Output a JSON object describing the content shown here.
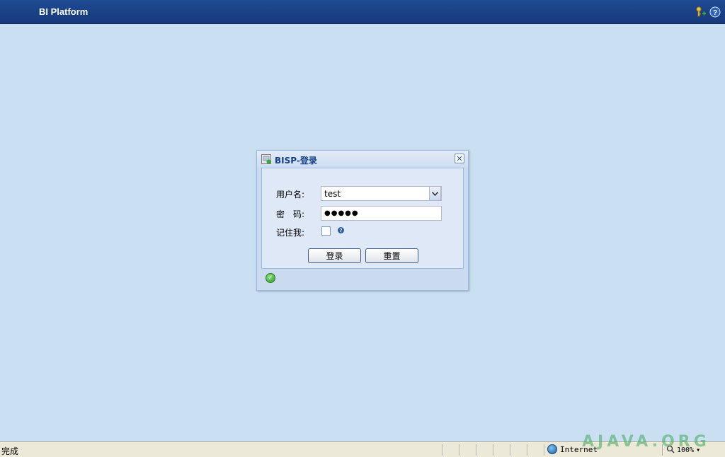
{
  "app": {
    "title": "BI Platform"
  },
  "header_icons": [
    "key-add-icon",
    "help-icon"
  ],
  "dialog": {
    "title": "BISP-登录",
    "username_label": "用户名:",
    "username_value": "test",
    "password_label": "密　码:",
    "password_value": "●●●●●",
    "remember_label": "记住我:",
    "remember_checked": false,
    "login_button": "登录",
    "reset_button": "重置"
  },
  "statusbar": {
    "status": "完成",
    "zone": "Internet",
    "zoom": "100%"
  },
  "watermark": "AJAVA.ORG",
  "colors": {
    "header": "#1f4b93",
    "background": "#cbdff3",
    "dialog_title": "#15428b"
  }
}
